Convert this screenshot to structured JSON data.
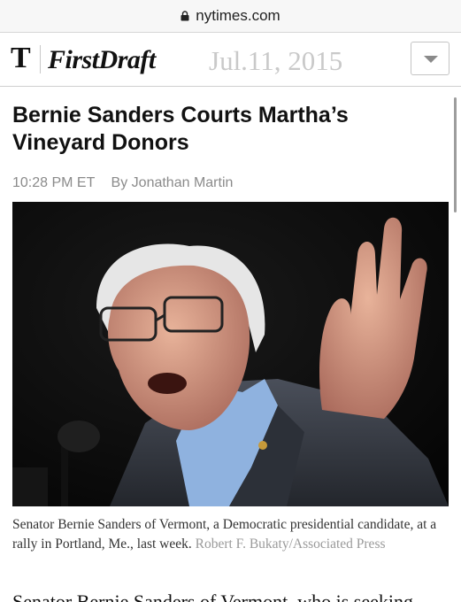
{
  "browser": {
    "url": "nytimes.com"
  },
  "masthead": {
    "logo_glyph": "T",
    "brand": "FirstDraft",
    "date": "Jul.11, 2015"
  },
  "article": {
    "headline": "Bernie Sanders Courts Martha’s Vineyard Donors",
    "time": "10:28 PM ET",
    "byline": "By Jonathan Martin",
    "caption": "Senator Bernie Sanders of Vermont, a  Democratic presidential candidate, at a rally in Portland, Me., last week.",
    "credit": "Robert F. Bukaty/Associated Press",
    "body_start": "Senator Bernie Sanders of Vermont, who is seeking"
  },
  "colors": {
    "date_gray": "#c9c9c9",
    "meta_gray": "#8b8b8b"
  }
}
